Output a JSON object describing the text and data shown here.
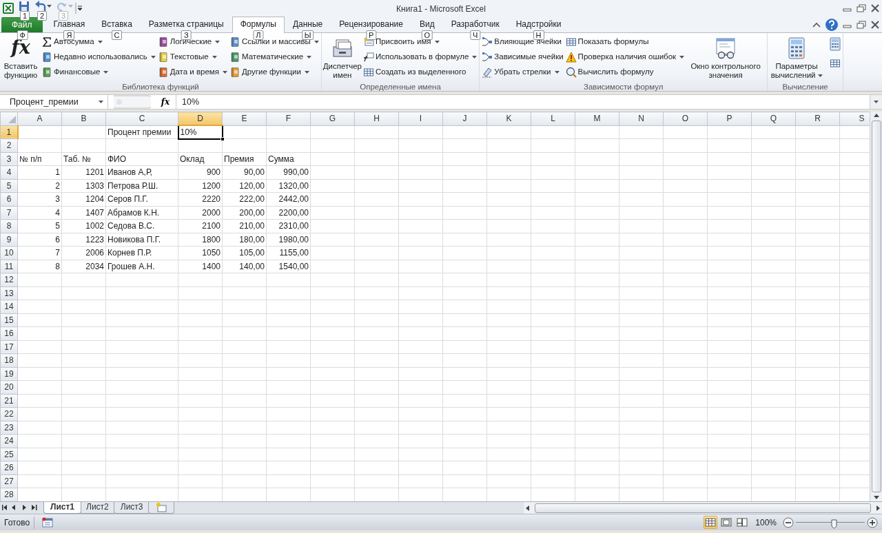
{
  "window": {
    "title": "Книга1 - Microsoft Excel"
  },
  "quick_access": [
    {
      "keytip": "1",
      "disabled": false
    },
    {
      "keytip": "2",
      "disabled": false
    },
    {
      "keytip": "3",
      "disabled": true
    }
  ],
  "tabs": [
    {
      "label": "Файл",
      "kind": "file",
      "keytip": "Ф",
      "selected": false
    },
    {
      "label": "Главная",
      "kind": "tab",
      "keytip": "Я",
      "selected": false
    },
    {
      "label": "Вставка",
      "kind": "tab",
      "keytip": "С",
      "selected": false
    },
    {
      "label": "Разметка страницы",
      "kind": "tab",
      "keytip": "З",
      "selected": false
    },
    {
      "label": "Формулы",
      "kind": "tab",
      "keytip": "Л",
      "selected": true
    },
    {
      "label": "Данные",
      "kind": "tab",
      "keytip": "Ы",
      "selected": false
    },
    {
      "label": "Рецензирование",
      "kind": "tab",
      "keytip": "Р",
      "selected": false
    },
    {
      "label": "Вид",
      "kind": "tab",
      "keytip": "О",
      "selected": false
    },
    {
      "label": "Разработчик",
      "kind": "tab",
      "keytip": "Ч",
      "selected": false
    },
    {
      "label": "Надстройки",
      "kind": "tab",
      "keytip": "Н",
      "selected": false
    }
  ],
  "ribbon": {
    "groups": [
      {
        "title": "Библиотека функций",
        "items": [
          {
            "kind": "large",
            "symbol": "fx",
            "label": "Вставить функцию",
            "dropdown": false
          },
          {
            "kind": "column",
            "buttons": [
              {
                "label": "Автосумма",
                "dropdown": true
              },
              {
                "label": "Недавно использовались",
                "dropdown": true
              },
              {
                "label": "Финансовые",
                "dropdown": true
              }
            ]
          },
          {
            "kind": "column",
            "buttons": [
              {
                "label": "Логические",
                "dropdown": true
              },
              {
                "label": "Текстовые",
                "dropdown": true
              },
              {
                "label": "Дата и время",
                "dropdown": true
              }
            ]
          },
          {
            "kind": "column",
            "buttons": [
              {
                "label": "Ссылки и массивы",
                "dropdown": true
              },
              {
                "label": "Математические",
                "dropdown": true
              },
              {
                "label": "Другие функции",
                "dropdown": true
              }
            ]
          }
        ]
      },
      {
        "title": "Определенные имена",
        "items": [
          {
            "kind": "large",
            "label": "Диспетчер имен",
            "dropdown": false
          },
          {
            "kind": "column",
            "buttons": [
              {
                "label": "Присвоить имя",
                "dropdown": true
              },
              {
                "label": "Использовать в формуле",
                "dropdown": true
              },
              {
                "label": "Создать из выделенного",
                "dropdown": false
              }
            ]
          }
        ]
      },
      {
        "title": "Зависимости формул",
        "items": [
          {
            "kind": "column",
            "buttons": [
              {
                "label": "Влияющие ячейки",
                "dropdown": false
              },
              {
                "label": "Зависимые ячейки",
                "dropdown": false
              },
              {
                "label": "Убрать стрелки",
                "dropdown": true
              }
            ]
          },
          {
            "kind": "column",
            "buttons": [
              {
                "label": "Показать формулы",
                "dropdown": false
              },
              {
                "label": "Проверка наличия ошибок",
                "dropdown": true
              },
              {
                "label": "Вычислить формулу",
                "dropdown": false
              }
            ]
          },
          {
            "kind": "large",
            "label": "Окно контрольного значения",
            "dropdown": false
          }
        ]
      },
      {
        "title": "Вычисление",
        "items": [
          {
            "kind": "large",
            "label": "Параметры вычислений",
            "dropdown": true
          },
          {
            "kind": "icon-column"
          }
        ]
      }
    ]
  },
  "formula_bar": {
    "name_box": "Процент_премии",
    "function_symbol": "fx",
    "formula": "10%"
  },
  "sheet": {
    "columns": [
      {
        "label": "A",
        "selected": false
      },
      {
        "label": "B",
        "selected": false
      },
      {
        "label": "C",
        "selected": false
      },
      {
        "label": "D",
        "selected": true
      },
      {
        "label": "E",
        "selected": false
      },
      {
        "label": "F",
        "selected": false
      },
      {
        "label": "G",
        "selected": false
      },
      {
        "label": "H",
        "selected": false
      },
      {
        "label": "I",
        "selected": false
      },
      {
        "label": "J",
        "selected": false
      },
      {
        "label": "K",
        "selected": false
      },
      {
        "label": "L",
        "selected": false
      },
      {
        "label": "M",
        "selected": false
      },
      {
        "label": "N",
        "selected": false
      },
      {
        "label": "O",
        "selected": false
      },
      {
        "label": "P",
        "selected": false
      },
      {
        "label": "Q",
        "selected": false
      },
      {
        "label": "R",
        "selected": false
      },
      {
        "label": "S",
        "selected": false
      }
    ],
    "rows": [
      {
        "header": "1",
        "selected": true,
        "cells": [
          {
            "kind": "empty",
            "selected": false
          },
          {
            "kind": "empty",
            "selected": false
          },
          {
            "kind": "text",
            "text": "Процент премии",
            "selected": false
          },
          {
            "kind": "text",
            "text": "10%",
            "selected": true
          }
        ]
      },
      {
        "header": "2",
        "selected": false
      },
      {
        "header": "3",
        "selected": false,
        "cells": [
          {
            "kind": "text",
            "text": "№ п/п",
            "selected": false
          },
          {
            "kind": "text",
            "text": "Таб. №",
            "selected": false
          },
          {
            "kind": "text",
            "text": "ФИО",
            "selected": false
          },
          {
            "kind": "text",
            "text": "Оклад",
            "selected": false
          },
          {
            "kind": "text",
            "text": "Премия",
            "selected": false
          },
          {
            "kind": "text",
            "text": "Сумма",
            "selected": false
          }
        ]
      },
      {
        "header": "4",
        "selected": false,
        "cells": [
          {
            "kind": "number",
            "text": "1",
            "selected": false
          },
          {
            "kind": "number",
            "text": "1201",
            "selected": false
          },
          {
            "kind": "text",
            "text": "Иванов А,Р,",
            "selected": false
          },
          {
            "kind": "number",
            "text": "900",
            "selected": false
          },
          {
            "kind": "number",
            "text": "90,00",
            "selected": false
          },
          {
            "kind": "number",
            "text": "990,00",
            "selected": false
          }
        ]
      },
      {
        "header": "5",
        "selected": false,
        "cells": [
          {
            "kind": "number",
            "text": "2",
            "selected": false
          },
          {
            "kind": "number",
            "text": "1303",
            "selected": false
          },
          {
            "kind": "text",
            "text": "Петрова Р.Ш.",
            "selected": false
          },
          {
            "kind": "number",
            "text": "1200",
            "selected": false
          },
          {
            "kind": "number",
            "text": "120,00",
            "selected": false
          },
          {
            "kind": "number",
            "text": "1320,00",
            "selected": false
          }
        ]
      },
      {
        "header": "6",
        "selected": false,
        "cells": [
          {
            "kind": "number",
            "text": "3",
            "selected": false
          },
          {
            "kind": "number",
            "text": "1204",
            "selected": false
          },
          {
            "kind": "text",
            "text": "Серов П.Г.",
            "selected": false
          },
          {
            "kind": "number",
            "text": "2220",
            "selected": false
          },
          {
            "kind": "number",
            "text": "222,00",
            "selected": false
          },
          {
            "kind": "number",
            "text": "2442,00",
            "selected": false
          }
        ]
      },
      {
        "header": "7",
        "selected": false,
        "cells": [
          {
            "kind": "number",
            "text": "4",
            "selected": false
          },
          {
            "kind": "number",
            "text": "1407",
            "selected": false
          },
          {
            "kind": "text",
            "text": "Абрамов К.Н.",
            "selected": false
          },
          {
            "kind": "number",
            "text": "2000",
            "selected": false
          },
          {
            "kind": "number",
            "text": "200,00",
            "selected": false
          },
          {
            "kind": "number",
            "text": "2200,00",
            "selected": false
          }
        ]
      },
      {
        "header": "8",
        "selected": false,
        "cells": [
          {
            "kind": "number",
            "text": "5",
            "selected": false
          },
          {
            "kind": "number",
            "text": "1002",
            "selected": false
          },
          {
            "kind": "text",
            "text": "Седова В.С.",
            "selected": false
          },
          {
            "kind": "number",
            "text": "2100",
            "selected": false
          },
          {
            "kind": "number",
            "text": "210,00",
            "selected": false
          },
          {
            "kind": "number",
            "text": "2310,00",
            "selected": false
          }
        ]
      },
      {
        "header": "9",
        "selected": false,
        "cells": [
          {
            "kind": "number",
            "text": "6",
            "selected": false
          },
          {
            "kind": "number",
            "text": "1223",
            "selected": false
          },
          {
            "kind": "text",
            "text": "Новикова П.Г.",
            "selected": false
          },
          {
            "kind": "number",
            "text": "1800",
            "selected": false
          },
          {
            "kind": "number",
            "text": "180,00",
            "selected": false
          },
          {
            "kind": "number",
            "text": "1980,00",
            "selected": false
          }
        ]
      },
      {
        "header": "10",
        "selected": false,
        "cells": [
          {
            "kind": "number",
            "text": "7",
            "selected": false
          },
          {
            "kind": "number",
            "text": "2006",
            "selected": false
          },
          {
            "kind": "text",
            "text": "Корнев П.Р.",
            "selected": false
          },
          {
            "kind": "number",
            "text": "1050",
            "selected": false
          },
          {
            "kind": "number",
            "text": "105,00",
            "selected": false
          },
          {
            "kind": "number",
            "text": "1155,00",
            "selected": false
          }
        ]
      },
      {
        "header": "11",
        "selected": false,
        "cells": [
          {
            "kind": "number",
            "text": "8",
            "selected": false
          },
          {
            "kind": "number",
            "text": "2034",
            "selected": false
          },
          {
            "kind": "text",
            "text": "Грошев А.Н.",
            "selected": false
          },
          {
            "kind": "number",
            "text": "1400",
            "selected": false
          },
          {
            "kind": "number",
            "text": "140,00",
            "selected": false
          },
          {
            "kind": "number",
            "text": "1540,00",
            "selected": false
          }
        ]
      },
      {
        "header": "12",
        "selected": false
      },
      {
        "header": "13",
        "selected": false
      },
      {
        "header": "14",
        "selected": false
      },
      {
        "header": "15",
        "selected": false
      },
      {
        "header": "16",
        "selected": false
      },
      {
        "header": "17",
        "selected": false
      },
      {
        "header": "18",
        "selected": false
      },
      {
        "header": "19",
        "selected": false
      },
      {
        "header": "20",
        "selected": false
      },
      {
        "header": "21",
        "selected": false
      },
      {
        "header": "22",
        "selected": false
      },
      {
        "header": "23",
        "selected": false
      },
      {
        "header": "24",
        "selected": false
      },
      {
        "header": "25",
        "selected": false
      },
      {
        "header": "26",
        "selected": false
      },
      {
        "header": "27",
        "selected": false
      },
      {
        "header": "28",
        "selected": false
      }
    ]
  },
  "sheet_tabs": [
    {
      "label": "Лист1",
      "selected": true
    },
    {
      "label": "Лист2",
      "selected": false
    },
    {
      "label": "Лист3",
      "selected": false
    }
  ],
  "status_bar": {
    "status": "Готово",
    "view_buttons": [
      {
        "kind": "normal",
        "selected": true
      },
      {
        "kind": "page-layout",
        "selected": false
      },
      {
        "kind": "page-break",
        "selected": false
      }
    ],
    "zoom": "100%",
    "zoom_slider": {
      "level": 0.55
    }
  }
}
